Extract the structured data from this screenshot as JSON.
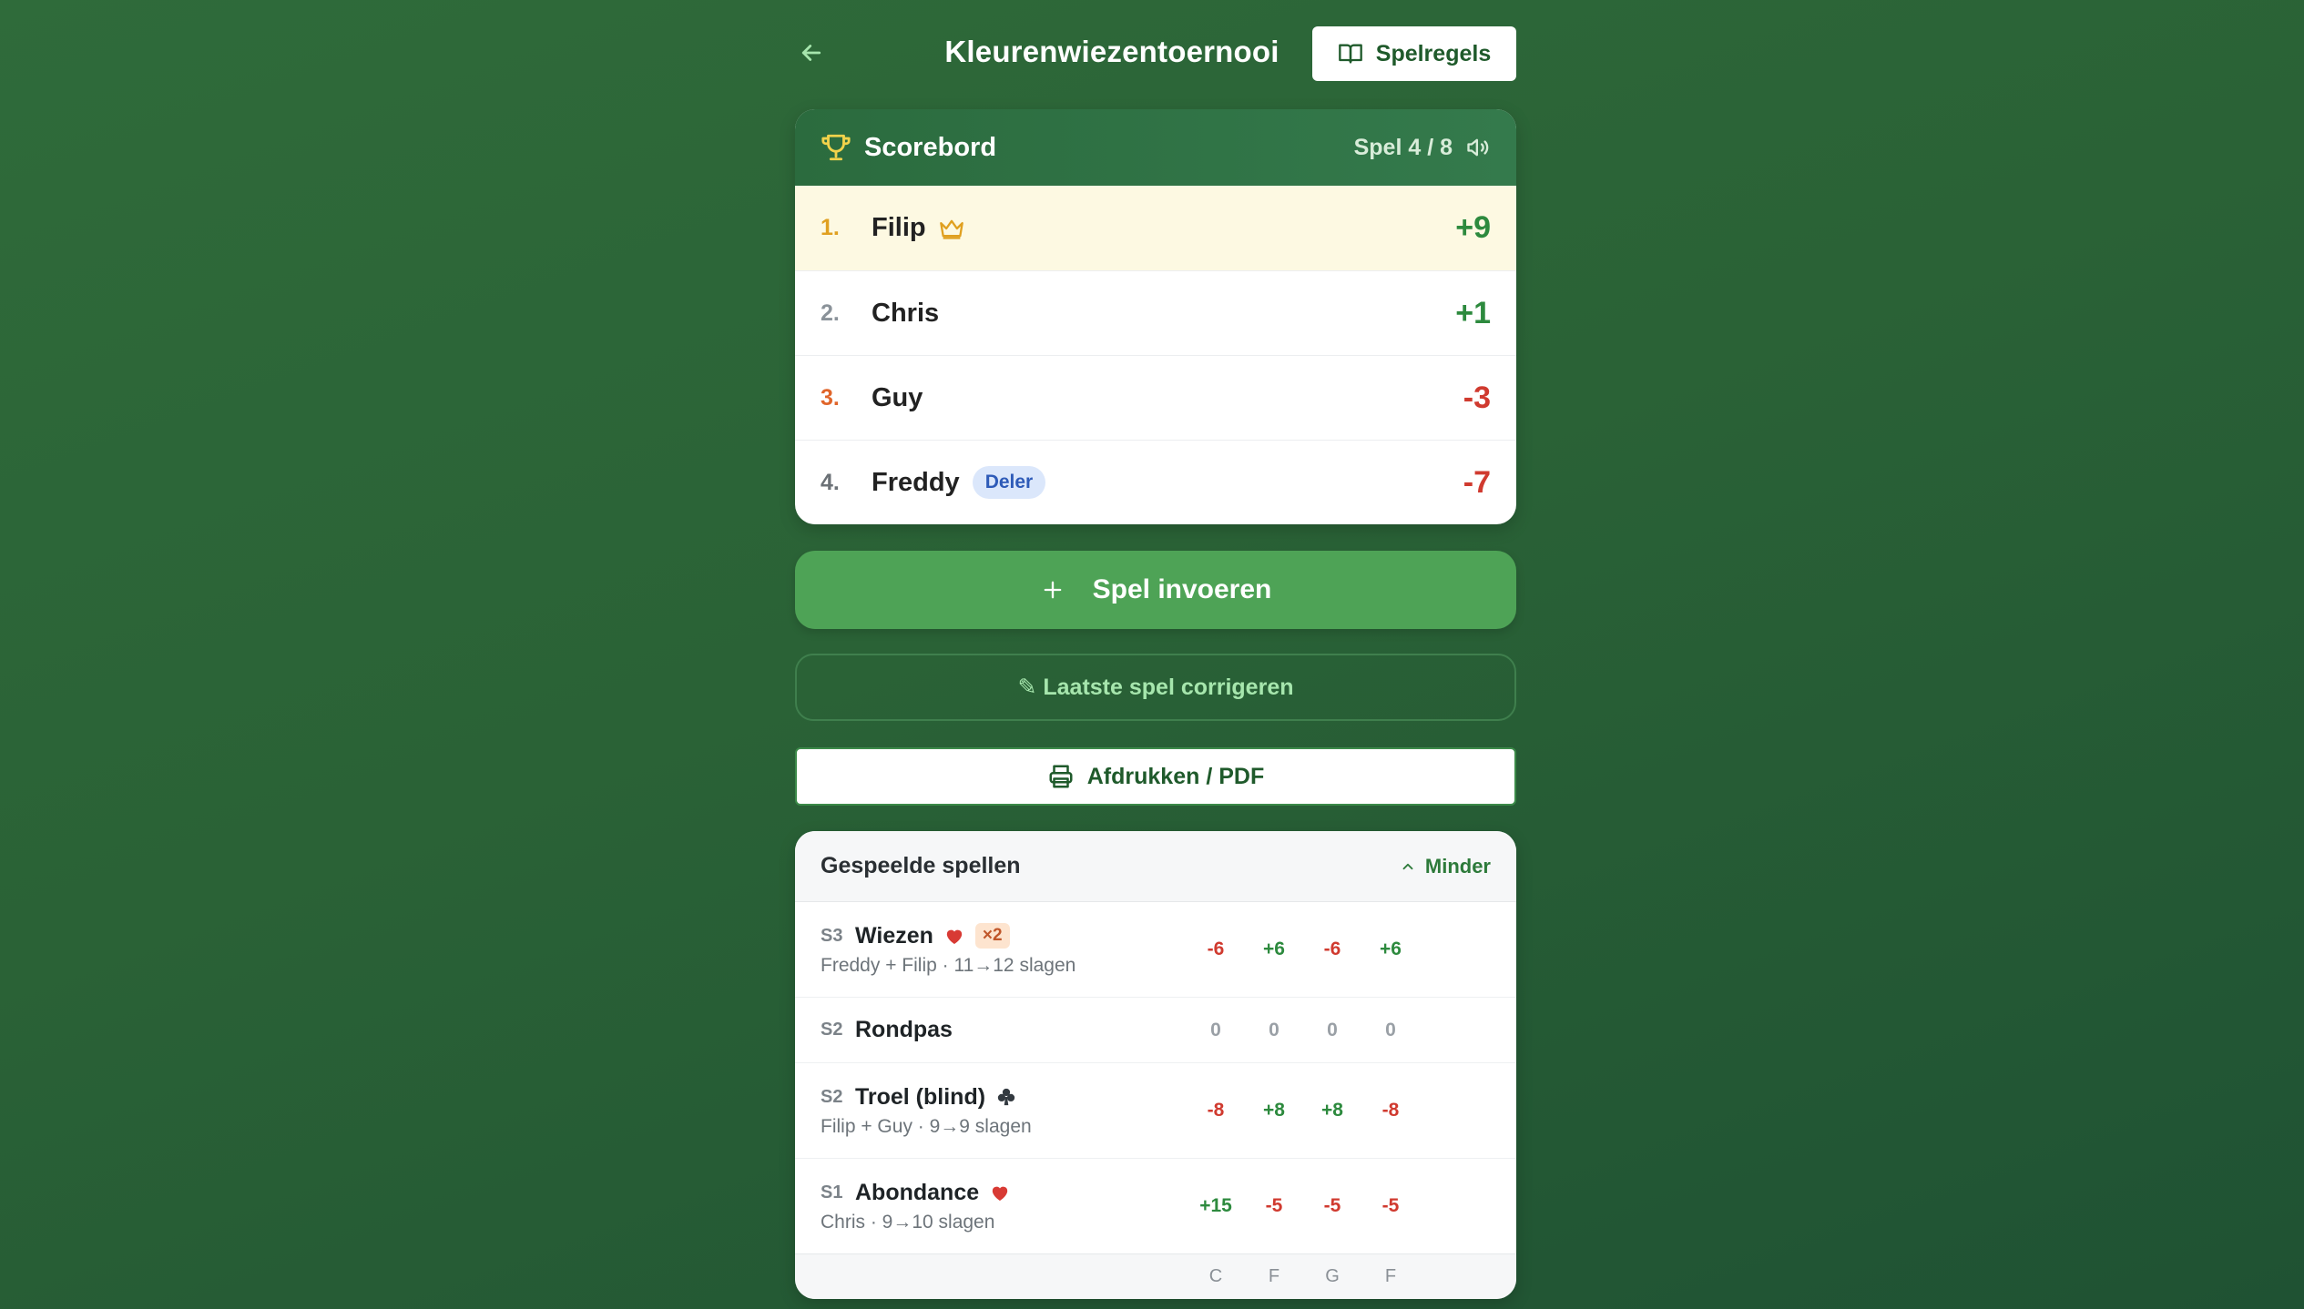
{
  "header": {
    "title": "Kleurenwiezentoernooi",
    "rules_button": "Spelregels"
  },
  "scoreboard": {
    "title": "Scorebord",
    "round": "Spel 4 / 8",
    "players": [
      {
        "rank": "1.",
        "name": "Filip",
        "score": "+9",
        "leader": true
      },
      {
        "rank": "2.",
        "name": "Chris",
        "score": "+1"
      },
      {
        "rank": "3.",
        "name": "Guy",
        "score": "-3"
      },
      {
        "rank": "4.",
        "name": "Freddy",
        "score": "-7",
        "badge": "Deler"
      }
    ]
  },
  "actions": {
    "enter_game": "Spel invoeren",
    "correct_last": "✎ Laatste spel corrigeren",
    "print": "Afdrukken / PDF"
  },
  "played_games": {
    "title": "Gespeelde spellen",
    "toggle": "Minder",
    "rows": [
      {
        "id": "S3",
        "name": "Wiezen",
        "suit": "heart",
        "multiplier": "×2",
        "detail": "Freddy + Filip · 11→12 slagen",
        "scores": [
          "-6",
          "+6",
          "-6",
          "+6"
        ]
      },
      {
        "id": "S2",
        "name": "Rondpas",
        "scores": [
          "0",
          "0",
          "0",
          "0"
        ]
      },
      {
        "id": "S2",
        "name": "Troel (blind)",
        "suit": "club",
        "detail": "Filip + Guy · 9→9 slagen",
        "scores": [
          "-8",
          "+8",
          "+8",
          "-8"
        ]
      },
      {
        "id": "S1",
        "name": "Abondance",
        "suit": "heart",
        "detail": "Chris · 9→10 slagen",
        "scores": [
          "+15",
          "-5",
          "-5",
          "-5"
        ]
      }
    ],
    "column_initials": [
      "C",
      "F",
      "G",
      "F"
    ]
  },
  "colors": {
    "positive": "#2d8a3e",
    "negative": "#d03a2f",
    "accent": "#4ea356",
    "header_green": "#2b6b3e",
    "leader_row": "#fdf9e2"
  }
}
